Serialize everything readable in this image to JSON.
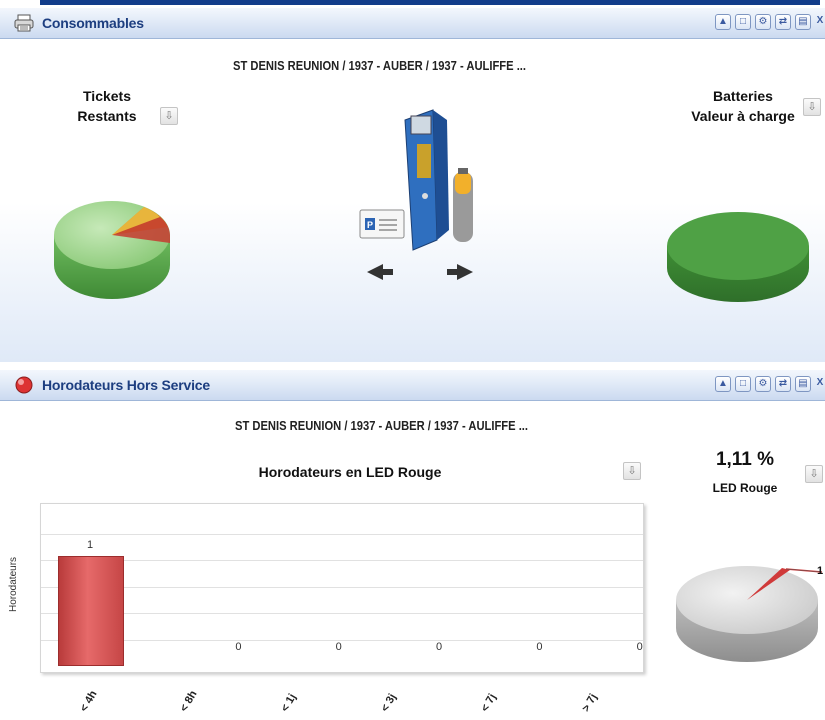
{
  "consommables": {
    "title": "Consommables",
    "location": "ST DENIS REUNION / 1937 - AUBER / 1937 - AULIFFE ...",
    "tickets_line1": "Tickets",
    "tickets_line2": "Restants",
    "batteries_line1": "Batteries",
    "batteries_line2": "Valeur à charge",
    "icon": "printer-icon"
  },
  "hors_service": {
    "title": "Horodateurs Hors Service",
    "location": "ST DENIS REUNION / 1937 - AUBER / 1937 - AULIFFE ...",
    "percent": "1,11 %",
    "percent_label": "LED Rouge",
    "pie_value_label": "1",
    "icon": "alert-icon"
  },
  "toolbar_icons": [
    "collapse-icon",
    "maximize-icon",
    "settings-icon",
    "refresh-icon",
    "print-icon",
    "close-icon"
  ],
  "colors": {
    "header_text": "#1d3e80",
    "bar": "#d65252",
    "pie_green": "#5fae4f",
    "pie_grey": "#bdbdbd"
  },
  "chart_data": [
    {
      "type": "bar",
      "title": "Horodateurs en LED Rouge",
      "ylabel": "Horodateurs",
      "xlabel": "",
      "categories": [
        "< 4h",
        "< 8h",
        "< 1j",
        "< 3j",
        "< 7j",
        "> 7j"
      ],
      "values": [
        1,
        0,
        0,
        0,
        0,
        0
      ],
      "ylim": [
        0,
        1.4
      ],
      "grid": true
    },
    {
      "type": "pie",
      "title": "",
      "slices": [
        {
          "label": "1",
          "value": 1.11
        },
        {
          "label": "",
          "value": 98.89
        }
      ]
    }
  ]
}
